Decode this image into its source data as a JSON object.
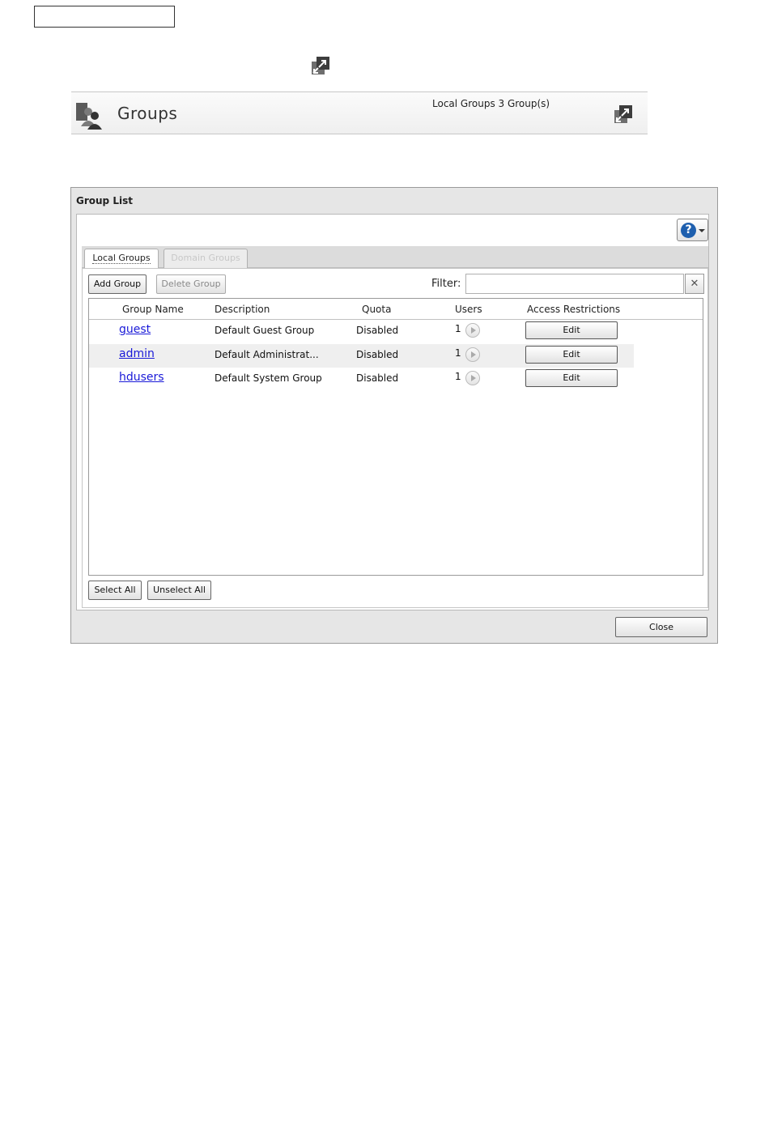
{
  "header": {
    "title": "Groups",
    "summary": "Local Groups 3 Group(s)"
  },
  "dialog": {
    "title": "Group List",
    "help_label": "?",
    "tabs": [
      {
        "label": "Local Groups",
        "active": true
      },
      {
        "label": "Domain Groups",
        "active": false
      }
    ],
    "toolbar": {
      "add_label": "Add Group",
      "delete_label": "Delete Group",
      "filter_label": "Filter:",
      "filter_value": "",
      "clear_label": "✕"
    },
    "columns": {
      "name": "Group Name",
      "description": "Description",
      "quota": "Quota",
      "users": "Users",
      "access": "Access Restrictions"
    },
    "rows": [
      {
        "name": "guest",
        "description": "Default Guest Group",
        "quota": "Disabled",
        "users": "1",
        "action": "Edit"
      },
      {
        "name": "admin",
        "description": "Default Administrat...",
        "quota": "Disabled",
        "users": "1",
        "action": "Edit"
      },
      {
        "name": "hdusers",
        "description": "Default System Group",
        "quota": "Disabled",
        "users": "1",
        "action": "Edit"
      }
    ],
    "footer": {
      "select_all": "Select All",
      "unselect_all": "Unselect All"
    },
    "close_label": "Close"
  },
  "icons": {
    "expand": "expand-icon",
    "groups": "groups-icon",
    "help": "help-icon",
    "play": "play-icon"
  },
  "colors": {
    "link": "#1a1ad8",
    "help_accent": "#1e5fae",
    "alt_row": "#efefef"
  }
}
